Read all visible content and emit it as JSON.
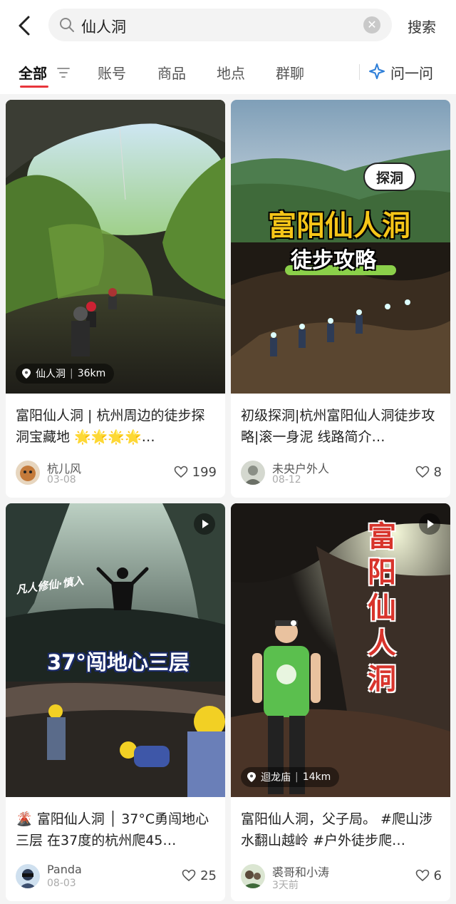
{
  "search": {
    "query": "仙人洞",
    "button_label": "搜索"
  },
  "tabs": {
    "all": "全部",
    "account": "账号",
    "goods": "商品",
    "place": "地点",
    "group": "群聊",
    "ask": "问一问"
  },
  "colors": {
    "accent": "#e8363c",
    "ask_icon": "#2f7fd8"
  },
  "cards": [
    {
      "title": "富阳仙人洞 | 杭州周边的徒步探洞宝藏地 🌟🌟🌟🌟…",
      "author": "杭儿风",
      "date": "03-08",
      "likes": "199",
      "location": {
        "name": "仙人洞",
        "distance": "36km"
      }
    },
    {
      "title": "初级探洞|杭州富阳仙人洞徒步攻略|滚一身泥 线路简介…",
      "author": "未央户外人",
      "date": "08-12",
      "likes": "8",
      "overlay": {
        "tag": "探洞",
        "headline": "富阳仙人洞",
        "sub": "徒步攻略"
      }
    },
    {
      "title": "🌋 富阳仙人洞 │ 37°C勇闯地心三层 在37度的杭州爬45…",
      "author": "Panda",
      "date": "08-03",
      "likes": "25",
      "overlay": {
        "tag": "凡人修仙·慎入",
        "headline": "37°闯地心三层"
      }
    },
    {
      "title": "富阳仙人洞，父子局。 #爬山涉水翻山越岭 #户外徒步爬…",
      "author": "裘哥和小涛",
      "date": "3天前",
      "likes": "6",
      "location": {
        "name": "迴龙庙",
        "distance": "14km"
      },
      "overlay": {
        "headline": "富阳仙人洞"
      }
    }
  ]
}
